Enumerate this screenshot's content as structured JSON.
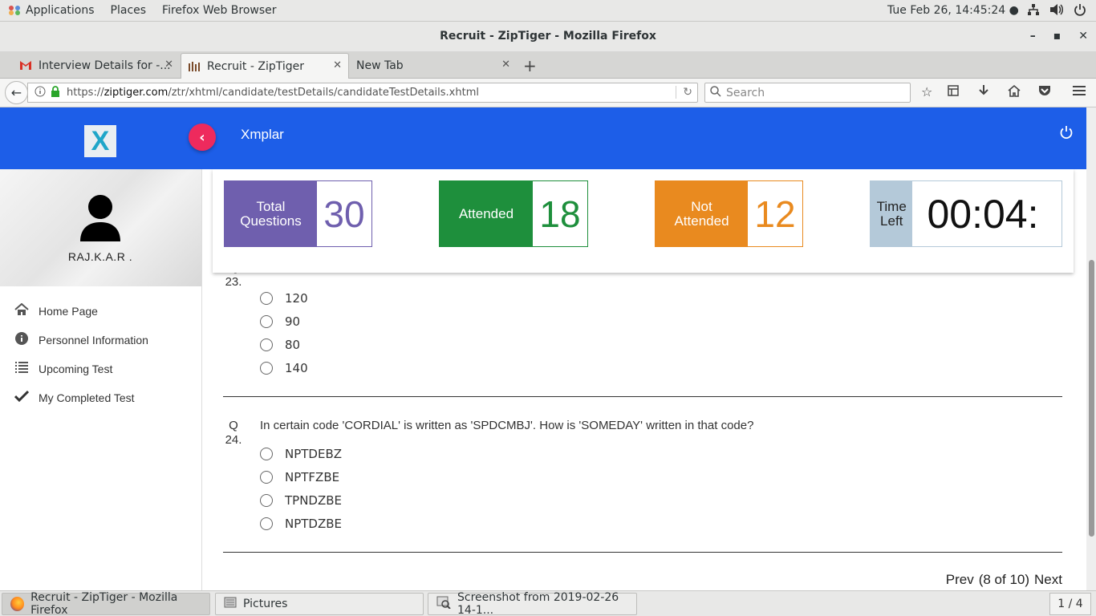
{
  "system_bar": {
    "applications": "Applications",
    "places": "Places",
    "app_name": "Firefox Web Browser",
    "clock": "Tue Feb 26, 14:45:24 ●"
  },
  "window": {
    "title": "Recruit - ZipTiger - Mozilla Firefox"
  },
  "tabs": [
    {
      "label": "Interview Details for -..."
    },
    {
      "label": "Recruit - ZipTiger"
    },
    {
      "label": "New Tab"
    }
  ],
  "navbar": {
    "url_prefix": "https://",
    "url_host": "ziptiger.com",
    "url_path": "/ztr/xhtml/candidate/testDetails/candidateTestDetails.xhtml",
    "search_placeholder": "Search"
  },
  "app": {
    "brand": "Xmplar",
    "logo_letter": "X",
    "username": "RAJ.K.A.R ."
  },
  "sidebar": {
    "items": [
      {
        "label": "Home Page",
        "icon": "home-icon"
      },
      {
        "label": "Personnel Information",
        "icon": "info-icon"
      },
      {
        "label": "Upcoming Test",
        "icon": "list-icon"
      },
      {
        "label": "My Completed Test",
        "icon": "check-icon"
      }
    ]
  },
  "stats": {
    "total_label": "Total Questions",
    "total_line1": "Total",
    "total_line2": "Questions",
    "total_value": "30",
    "attended_label": "Attended",
    "attended_value": "18",
    "not_attended_line1": "Not",
    "not_attended_line2": "Attended",
    "not_attended_value": "12",
    "time_line1": "Time",
    "time_line2": "Left",
    "time_value": "00:04:",
    "colors": {
      "total": "#6f5fae",
      "attended": "#1e8f3c",
      "not_attended": "#e98a1f",
      "time": "#b4c9d9"
    }
  },
  "questions": [
    {
      "number_prefix": "Q",
      "number": "23.",
      "text": "",
      "options": [
        "120",
        "90",
        "80",
        "140"
      ]
    },
    {
      "number_prefix": "Q",
      "number": "24.",
      "text": "In certain code 'CORDIAL' is written as 'SPDCMBJ'. How is 'SOMEDAY' written in that code?",
      "options": [
        "NPTDEBZ",
        "NPTFZBE",
        "TPNDZBE",
        "NPTDZBE"
      ]
    }
  ],
  "pager": {
    "prev": "Prev",
    "status": "(8 of 10)",
    "next": "Next"
  },
  "taskbar": {
    "items": [
      {
        "label": "Recruit - ZipTiger - Mozilla Firefox"
      },
      {
        "label": "Pictures"
      },
      {
        "label": "Screenshot from 2019-02-26 14-1..."
      }
    ],
    "workspace": "1 / 4"
  }
}
